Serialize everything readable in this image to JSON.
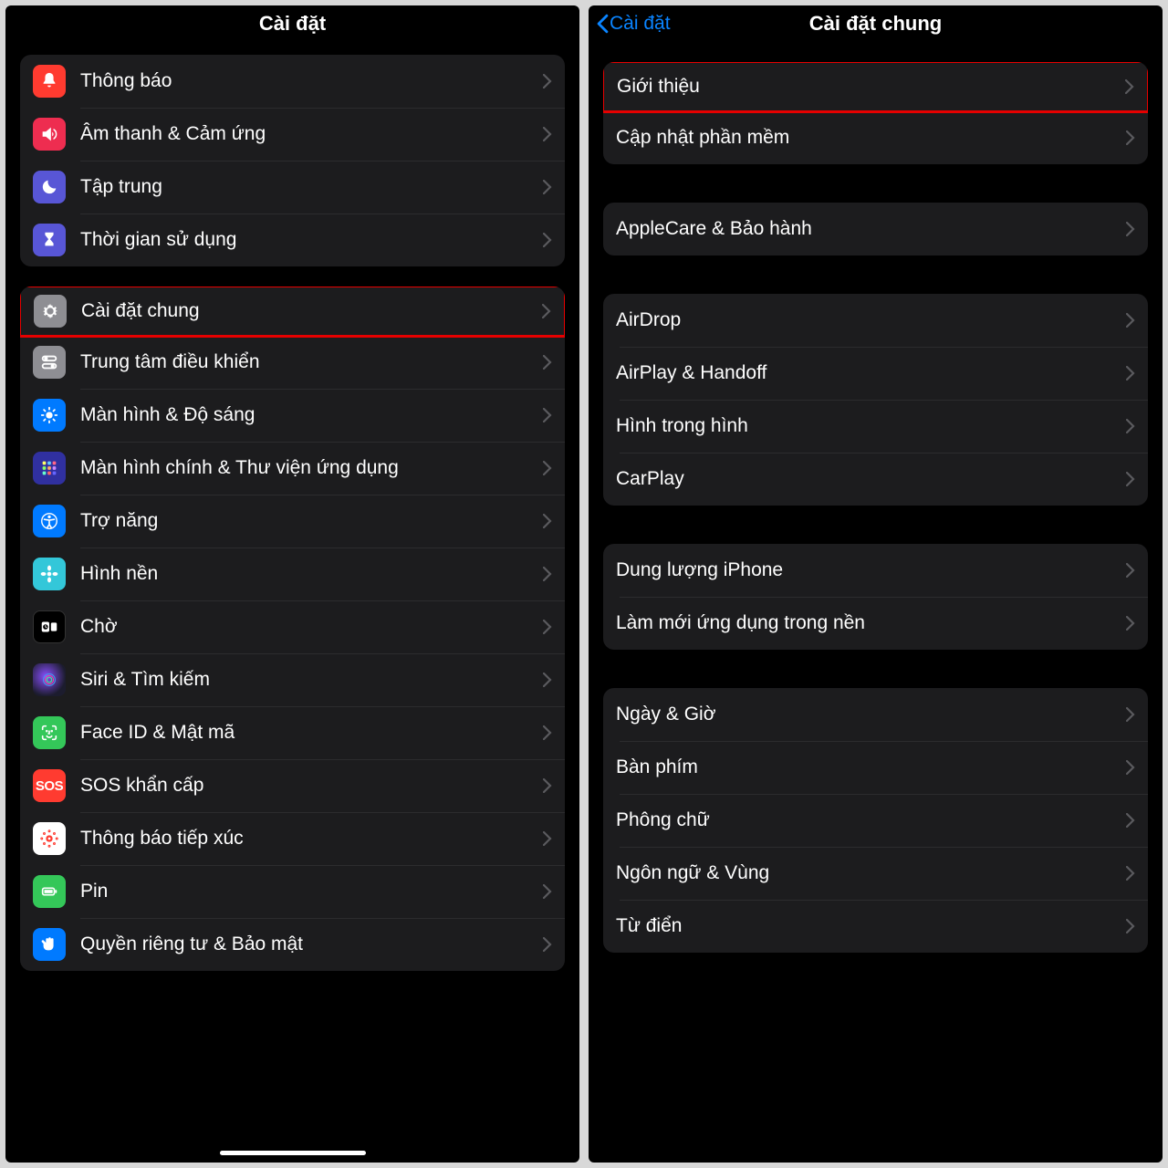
{
  "left": {
    "title": "Cài đặt",
    "groups": [
      {
        "items": [
          {
            "name": "notifications",
            "label": "Thông báo",
            "icon": "bell",
            "bg": "#ff3b30"
          },
          {
            "name": "sounds",
            "label": "Âm thanh & Cảm ứng",
            "icon": "speaker",
            "bg": "#ee2d50"
          },
          {
            "name": "focus",
            "label": "Tập trung",
            "icon": "moon",
            "bg": "#5856d6"
          },
          {
            "name": "screentime",
            "label": "Thời gian sử dụng",
            "icon": "hourglass",
            "bg": "#5856d6"
          }
        ]
      },
      {
        "items": [
          {
            "name": "general",
            "label": "Cài đặt chung",
            "icon": "gear",
            "bg": "#8e8e93",
            "highlight": true
          },
          {
            "name": "control-center",
            "label": "Trung tâm điều khiển",
            "icon": "switches",
            "bg": "#8e8e93"
          },
          {
            "name": "display",
            "label": "Màn hình & Độ sáng",
            "icon": "sun",
            "bg": "#007aff"
          },
          {
            "name": "homescreen",
            "label": "Màn hình chính & Thư viện ứng dụng",
            "icon": "apps",
            "bg": "#4040b0"
          },
          {
            "name": "accessibility",
            "label": "Trợ năng",
            "icon": "access",
            "bg": "#007aff"
          },
          {
            "name": "wallpaper",
            "label": "Hình nền",
            "icon": "flower",
            "bg": "#33c7d9"
          },
          {
            "name": "standby",
            "label": "Chờ",
            "icon": "standby",
            "bg": "#000000"
          },
          {
            "name": "siri",
            "label": "Siri & Tìm kiếm",
            "icon": "siri",
            "bg": "#1a1a1a"
          },
          {
            "name": "faceid",
            "label": "Face ID & Mật mã",
            "icon": "faceid",
            "bg": "#34c759"
          },
          {
            "name": "sos",
            "label": "SOS khẩn cấp",
            "icon": "sos",
            "bg": "#ff3b30"
          },
          {
            "name": "exposure",
            "label": "Thông báo tiếp xúc",
            "icon": "exposure",
            "bg": "#ffffff"
          },
          {
            "name": "battery",
            "label": "Pin",
            "icon": "battery",
            "bg": "#34c759"
          },
          {
            "name": "privacy",
            "label": "Quyền riêng tư & Bảo mật",
            "icon": "hand",
            "bg": "#007aff"
          }
        ]
      }
    ]
  },
  "right": {
    "title": "Cài đặt chung",
    "back": "Cài đặt",
    "groups": [
      [
        {
          "name": "about",
          "label": "Giới thiệu",
          "highlight": true
        },
        {
          "name": "software-update",
          "label": "Cập nhật phần mềm"
        }
      ],
      [
        {
          "name": "applecare",
          "label": "AppleCare & Bảo hành"
        }
      ],
      [
        {
          "name": "airdrop",
          "label": "AirDrop"
        },
        {
          "name": "airplay",
          "label": "AirPlay & Handoff"
        },
        {
          "name": "pip",
          "label": "Hình trong hình"
        },
        {
          "name": "carplay",
          "label": "CarPlay"
        }
      ],
      [
        {
          "name": "storage",
          "label": "Dung lượng iPhone"
        },
        {
          "name": "background-refresh",
          "label": "Làm mới ứng dụng trong nền"
        }
      ],
      [
        {
          "name": "datetime",
          "label": "Ngày & Giờ"
        },
        {
          "name": "keyboard",
          "label": "Bàn phím"
        },
        {
          "name": "fonts",
          "label": "Phông chữ"
        },
        {
          "name": "language",
          "label": "Ngôn ngữ & Vùng"
        },
        {
          "name": "dictionary",
          "label": "Từ điển"
        }
      ]
    ]
  },
  "colors": {
    "highlight": "#e60000",
    "link": "#0a84ff"
  }
}
